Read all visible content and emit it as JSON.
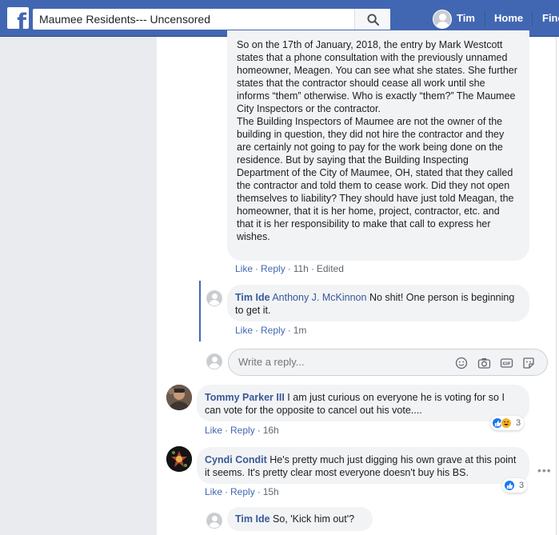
{
  "topbar": {
    "logo": "f",
    "search_value": "Maumee Residents--- Uncensored",
    "user_name": "Tim",
    "home_label": "Home",
    "find_label": "Find"
  },
  "comment_main": {
    "paragraph1": "So on the 17th of January, 2018, the entry by Mark Westcott states that a phone consultation with the previously unnamed homeowner, Meagen. You can see what she states. She further states that the contractor should cease all work until she informs “them” otherwise. Who is exactly “them?” The Maumee City Inspectors or the contractor.",
    "paragraph2": "The Building Inspectors of Maumee are not the owner of the building in question, they did not hire the contractor and they are certainly not going to pay for the work being done on the residence. But by saying that the Building Inspecting Department of the City of Maumee, OH, stated that they called the contractor and told them to cease work. Did they not open themselves to liability? They should have just told Meagan, the homeowner, that it is her home, project, contractor, etc. and that it is her responsibility to make that call to express her wishes.",
    "like": "Like",
    "reply": "Reply",
    "time": "11h",
    "edited": "Edited"
  },
  "reply_tim": {
    "author": "Tim Ide",
    "tag": "Anthony J. McKinnon",
    "text": "No shit! One person is beginning to get it.",
    "like": "Like",
    "reply": "Reply",
    "time": "1m"
  },
  "reply_input": {
    "placeholder": "Write a reply..."
  },
  "comment_tommy": {
    "author": "Tommy Parker III",
    "text": "I am just curious on everyone he is voting for so I can vote for the opposite to cancel out his vote....",
    "like": "Like",
    "reply": "Reply",
    "time": "16h",
    "reaction_count": "3"
  },
  "comment_cyndi": {
    "author": "Cyndi Condit",
    "text": "He's pretty much just digging his own grave at this point it seems. It's pretty clear most everyone doesn't buy his BS.",
    "like": "Like",
    "reply": "Reply",
    "time": "15h",
    "reaction_count": "3"
  },
  "reply_tim2": {
    "author": "Tim Ide",
    "text": "So, 'Kick him out'?"
  },
  "colors": {
    "brand": "#4267b2",
    "link": "#385898",
    "bubble": "#f2f3f5",
    "sidebar": "#e9ebee"
  }
}
